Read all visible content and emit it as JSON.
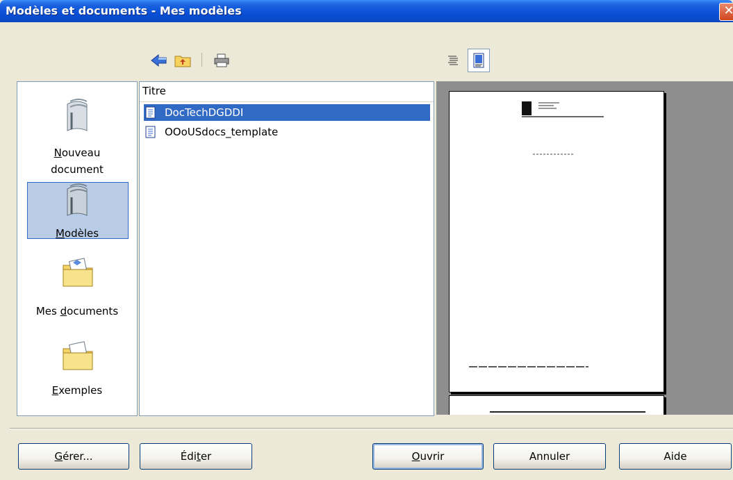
{
  "window": {
    "title": "Modèles et documents - Mes modèles",
    "close_glyph": "✕"
  },
  "toolbar": {
    "icons": [
      "back-arrow-icon",
      "folder-up-icon",
      "print-icon",
      "details-view-icon",
      "preview-view-icon"
    ]
  },
  "categories": [
    {
      "label_parts": [
        "",
        "N",
        "ouveau"
      ],
      "label_line2": "document",
      "icon": "new-document-icon",
      "selected": false
    },
    {
      "label_parts": [
        "",
        "M",
        "odèles"
      ],
      "icon": "templates-icon",
      "selected": true
    },
    {
      "label_parts": [
        "Mes ",
        "d",
        "ocuments"
      ],
      "icon": "my-documents-folder-icon",
      "selected": false
    },
    {
      "label_parts": [
        "",
        "E",
        "xemples"
      ],
      "icon": "examples-folder-icon",
      "selected": false
    }
  ],
  "list": {
    "column_header": "Titre",
    "rows": [
      {
        "label": "DocTechDGDDI",
        "selected": true
      },
      {
        "label": "OOoUSdocs_template",
        "selected": false
      }
    ]
  },
  "buttons": {
    "manage": [
      "",
      "G",
      "érer..."
    ],
    "edit": [
      "Édi",
      "t",
      "er"
    ],
    "open": [
      "",
      "O",
      "uvrir"
    ],
    "cancel": "Annuler",
    "help": "Aide"
  }
}
